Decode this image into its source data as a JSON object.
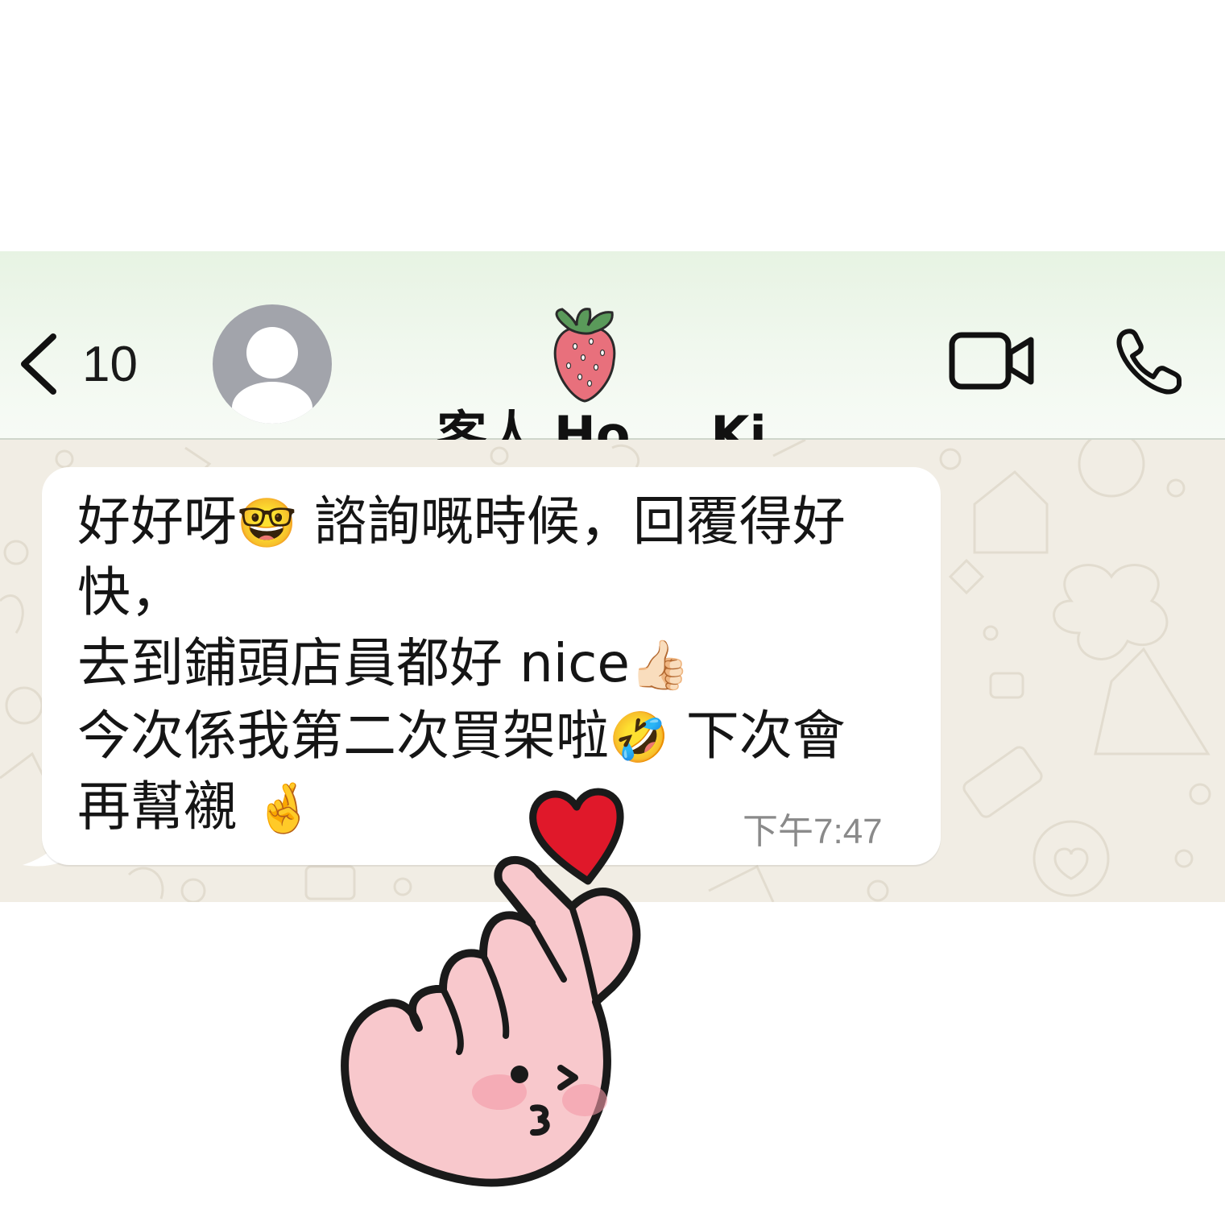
{
  "header": {
    "back_count": "10",
    "contact_name_part1": "客人 Ho",
    "contact_name_part2": "Ki",
    "video_icon": "video-call-icon",
    "call_icon": "phone-icon"
  },
  "message": {
    "lines": [
      {
        "text_a": "好好呀",
        "emoji_a": "🤓",
        "text_b": " 諮詢嘅時候，回覆得好"
      },
      {
        "text_a": "快，"
      },
      {
        "text_a": "去到鋪頭店員都好 nice",
        "emoji_a": "👍🏻"
      },
      {
        "text_a": "今次係我第二次買架啦",
        "emoji_a": "🤣",
        "text_b": " 下次會"
      },
      {
        "text_a": "再幫襯 ",
        "emoji_a": "🤞"
      }
    ],
    "timestamp": "下午7:47"
  },
  "colors": {
    "header_bg": "#e9f4e6",
    "chat_bg": "#f1ede4",
    "bubble_bg": "#ffffff",
    "heart": "#e0182a",
    "hand": "#f8c8cc",
    "strawberry": "#e36f7a"
  }
}
